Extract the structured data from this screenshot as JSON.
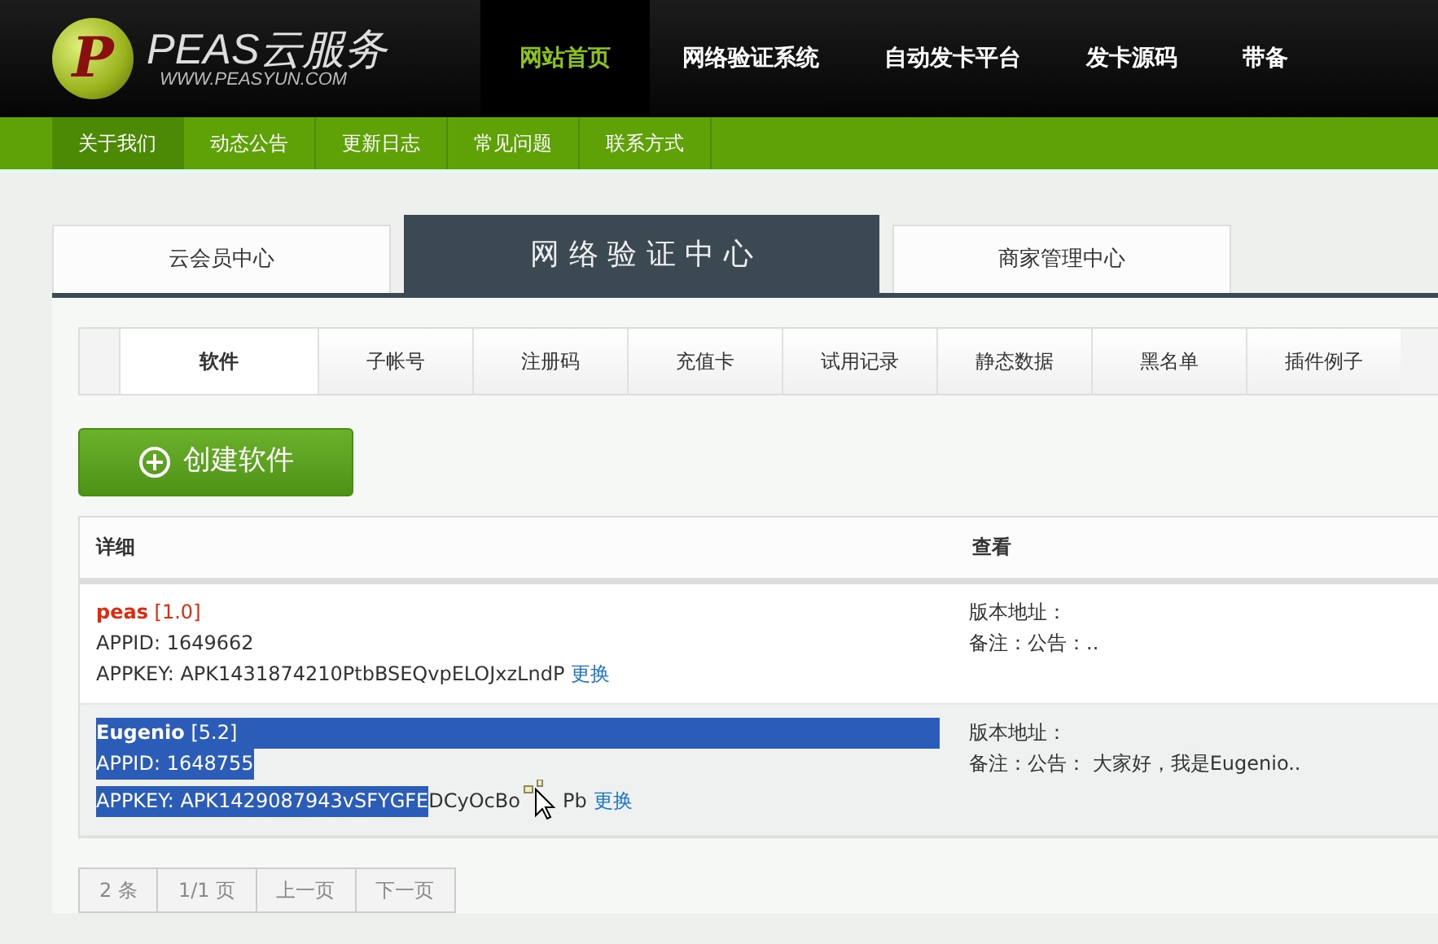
{
  "logo": {
    "letter": "P",
    "title": "PEAS云服务",
    "url": "WWW.PEASYUN.COM"
  },
  "main_nav": [
    {
      "label": "网站首页",
      "selected": true
    },
    {
      "label": "网络验证系统",
      "selected": false
    },
    {
      "label": "自动发卡平台",
      "selected": false
    },
    {
      "label": "发卡源码",
      "selected": false
    },
    {
      "label": "带备",
      "selected": false
    }
  ],
  "sub_nav": [
    {
      "label": "关于我们",
      "selected": true
    },
    {
      "label": "动态公告",
      "selected": false
    },
    {
      "label": "更新日志",
      "selected": false
    },
    {
      "label": "常见问题",
      "selected": false
    },
    {
      "label": "联系方式",
      "selected": false
    }
  ],
  "center_tabs": [
    {
      "label": "云会员中心",
      "selected": false
    },
    {
      "label": "网 络 验 证 中 心",
      "selected": true
    },
    {
      "label": "商家管理中心",
      "selected": false
    }
  ],
  "tabs": [
    {
      "label": "软件",
      "selected": true
    },
    {
      "label": "子帐号",
      "selected": false
    },
    {
      "label": "注册码",
      "selected": false
    },
    {
      "label": "充值卡",
      "selected": false
    },
    {
      "label": "试用记录",
      "selected": false
    },
    {
      "label": "静态数据",
      "selected": false
    },
    {
      "label": "黑名单",
      "selected": false
    },
    {
      "label": "插件例子",
      "selected": false
    }
  ],
  "create_button": "创建软件",
  "table": {
    "columns": [
      "详细",
      "查看"
    ],
    "rows": [
      {
        "name": "peas",
        "version": "[1.0]",
        "appid": "APPID: 1649662",
        "appkey": [
          {
            "text": "APPKEY: APK1431874210PtbBSEQvpELOJxzLndP",
            "selected": false
          }
        ],
        "change": "更换",
        "url_label": "版本地址：",
        "note": "备注：公告：..",
        "selected": false
      },
      {
        "name": "Eugenio",
        "version": "[5.2]",
        "appid": "APPID: 1648755",
        "appkey": [
          {
            "text": "APPKEY: APK1429087943vSFYGFE",
            "selected": true
          },
          {
            "text": "DCyOcBo",
            "selected": false
          },
          {
            "text": "Pb",
            "selected": false
          }
        ],
        "change": "更换",
        "url_label": "版本地址：",
        "note": "备注：公告： 大家好，我是Eugenio..",
        "selected": true
      }
    ]
  },
  "pager": [
    "2 条",
    "1/1 页",
    "上一页",
    "下一页"
  ]
}
